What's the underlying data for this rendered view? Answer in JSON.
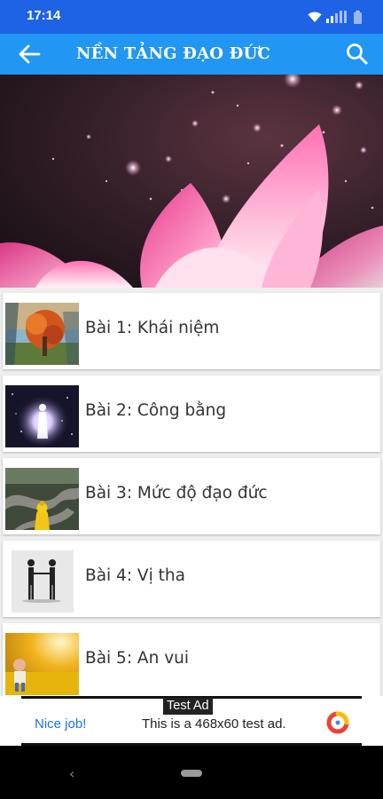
{
  "status_bar": {
    "time": "17:14",
    "icons": [
      "wifi-icon",
      "signal-icon",
      "battery-icon"
    ]
  },
  "app_bar": {
    "title": "NỀN TẢNG ĐẠO ĐỨC",
    "back_icon": "arrow-left-icon",
    "search_icon": "search-icon"
  },
  "hero": {
    "image": "pink-lotus-petals-with-glowing-particles"
  },
  "lessons": [
    {
      "label": "Bài 1: Khái niệm",
      "thumbnail": "autumn-tree-landscape"
    },
    {
      "label": "Bài 2: Công bằng",
      "thumbnail": "glowing-figure-in-starfield"
    },
    {
      "label": "Bài 3: Mức độ đạo đức",
      "thumbnail": "golden-buddha-statue-on-winding-road"
    },
    {
      "label": "Bài 4: Vị tha",
      "thumbnail": "two-figures-silhouette-handshake"
    },
    {
      "label": "Bài 5: An vui",
      "thumbnail": "child-in-yellow-flower-field"
    }
  ],
  "ad": {
    "badge": "Test Ad",
    "headline": "Nice job!",
    "text": "This is a 468x60 test ad.",
    "logo": "admob-logo-icon"
  },
  "colors": {
    "status_bar": "#1e63e5",
    "app_bar": "#2196f3",
    "ad_link": "#1a73e8"
  }
}
